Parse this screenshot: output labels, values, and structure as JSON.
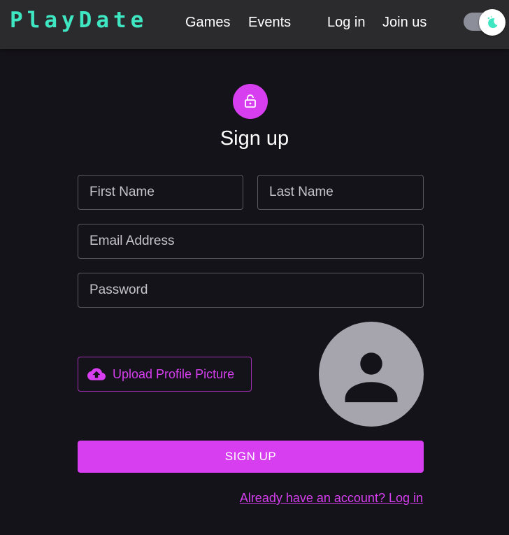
{
  "header": {
    "logo": "PlayDate",
    "nav": [
      "Games",
      "Events"
    ],
    "login": "Log in",
    "join": "Join us",
    "theme_toggle_icon": "moon-icon"
  },
  "form": {
    "title": "Sign up",
    "lock_icon": "lock-open-icon",
    "first_name_placeholder": "First Name",
    "last_name_placeholder": "Last Name",
    "email_placeholder": "Email Address",
    "password_placeholder": "Password",
    "upload_label": "Upload Profile Picture",
    "upload_icon": "cloud-upload-icon",
    "avatar_icon": "person-icon",
    "submit_label": "SIGN UP",
    "login_link": "Already have an account? Log in"
  },
  "colors": {
    "background": "#141319",
    "header": "#2b2b2e",
    "logo": "#3ee6c1",
    "accent": "#d63ef0",
    "avatar": "#a6a5ad"
  }
}
